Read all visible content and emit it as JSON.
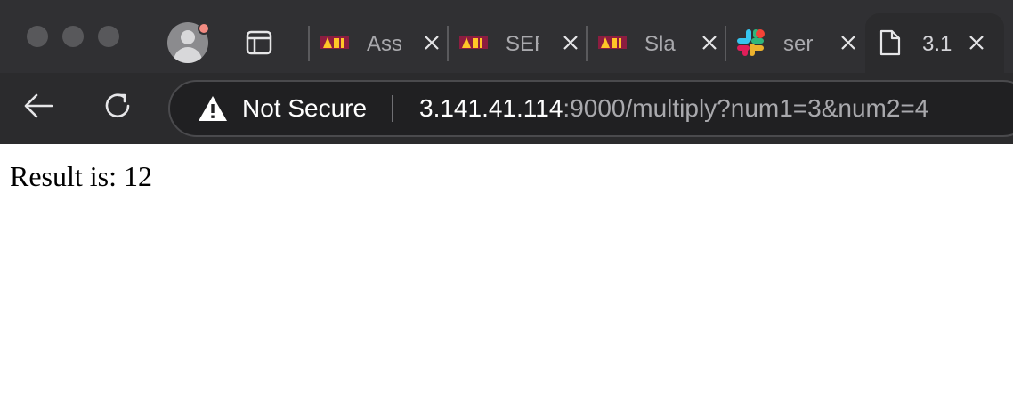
{
  "window": {
    "traffic_lights": [
      "close",
      "minimize",
      "zoom"
    ]
  },
  "toolbar": {
    "profile_icon": "profile-avatar-icon",
    "sidebar_icon": "sidebar-toggle-icon"
  },
  "tabs": [
    {
      "title": "Ass",
      "favicon": "asu-logo-icon",
      "active": false
    },
    {
      "title": "SER",
      "favicon": "asu-logo-icon",
      "active": false
    },
    {
      "title": "Sla",
      "favicon": "asu-logo-icon",
      "active": false
    },
    {
      "title": "ser",
      "favicon": "slack-logo-icon",
      "active": false
    },
    {
      "title": "3.1",
      "favicon": "document-icon",
      "active": true
    }
  ],
  "nav": {
    "back_icon": "back-arrow-icon",
    "reload_icon": "reload-icon"
  },
  "omnibox": {
    "security_label": "Not Secure",
    "security_icon": "warning-triangle-icon",
    "url_host": "3.141.41.114",
    "url_rest": ":9000/multiply?num1=3&num2=4"
  },
  "page": {
    "result_text": "Result is: 12"
  },
  "colors": {
    "chrome_bg": "#2b2b2d",
    "tabstrip_bg": "#303033",
    "asu_maroon": "#8c1d40",
    "asu_gold": "#ffc627",
    "profile_badge": "#f28b82"
  }
}
